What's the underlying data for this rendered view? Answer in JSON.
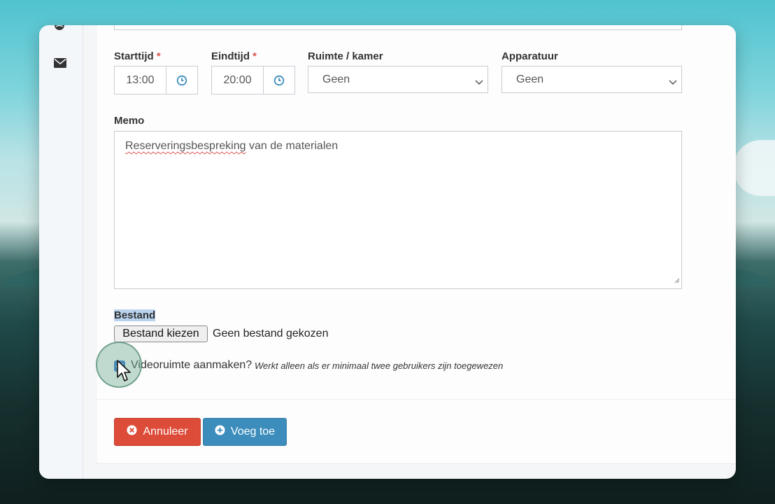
{
  "sidebar": {
    "icons": [
      "globe-icon",
      "envelope-icon"
    ]
  },
  "form": {
    "start_time": {
      "label": "Starttijd",
      "required_mark": "*",
      "value": "13:00"
    },
    "end_time": {
      "label": "Eindtijd",
      "required_mark": "*",
      "value": "20:00"
    },
    "room": {
      "label": "Ruimte / kamer",
      "value": "Geen"
    },
    "equipment": {
      "label": "Apparatuur",
      "value": "Geen"
    },
    "memo": {
      "label": "Memo",
      "value_misspelled": "Reserveringsbespreking",
      "value_rest": " van de materialen"
    },
    "file": {
      "label": "Bestand",
      "button_label": "Bestand kiezen",
      "status": "Geen bestand gekozen"
    },
    "video_room": {
      "checked": true,
      "label": "Videoruimte aanmaken?",
      "hint": "Werkt alleen als er minimaal twee gebruikers zijn toegewezen"
    }
  },
  "actions": {
    "cancel_label": "Annuleer",
    "add_label": "Voeg toe"
  },
  "colors": {
    "cancel": "#dd4b39",
    "add": "#3c8dbc",
    "required": "#d9534f",
    "addon_icon": "#3c8dbc",
    "checkbox": "#1f6fd1"
  }
}
